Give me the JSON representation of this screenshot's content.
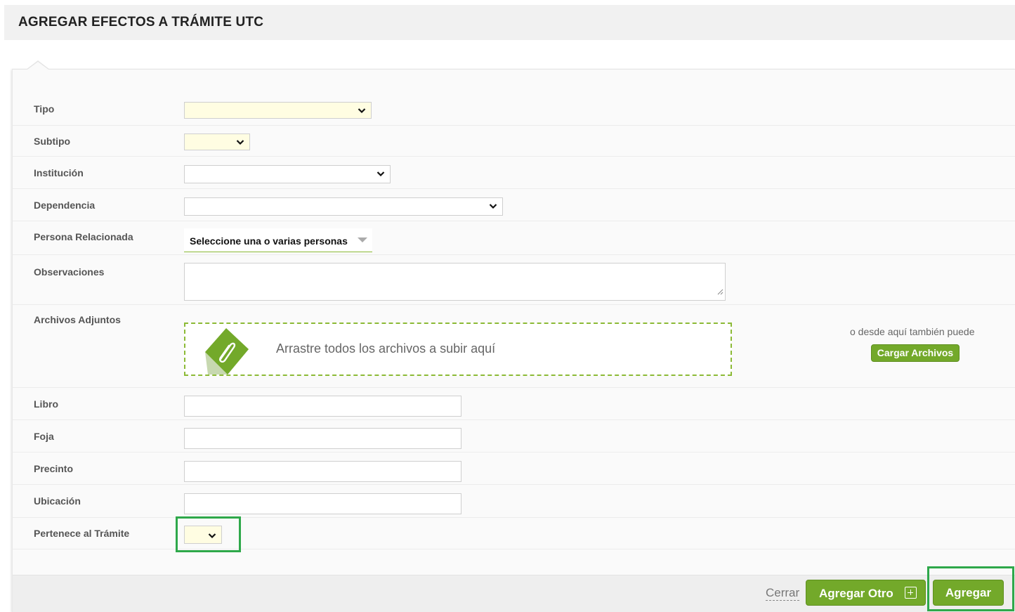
{
  "header": {
    "title": "AGREGAR EFECTOS A TRÁMITE UTC"
  },
  "form": {
    "tipo_label": "Tipo",
    "subtipo_label": "Subtipo",
    "institucion_label": "Institución",
    "dependencia_label": "Dependencia",
    "persona_label": "Persona Relacionada",
    "persona_placeholder": "Seleccione una o varias personas",
    "observaciones_label": "Observaciones",
    "archivos_label": "Archivos Adjuntos",
    "dropzone_text": "Arrastre todos los archivos a subir aquí",
    "side_note": "o desde aquí también puede",
    "cargar_button": "Cargar Archivos",
    "libro_label": "Libro",
    "foja_label": "Foja",
    "precinto_label": "Precinto",
    "ubicacion_label": "Ubicación",
    "pertenece_label": "Pertenece al Trámite"
  },
  "footer": {
    "cerrar": "Cerrar",
    "agregar_otro": "Agregar Otro",
    "agregar": "Agregar"
  },
  "colors": {
    "accent_green": "#73a92a",
    "highlight_green": "#2ea84a",
    "required_field_bg": "#fffde2"
  }
}
